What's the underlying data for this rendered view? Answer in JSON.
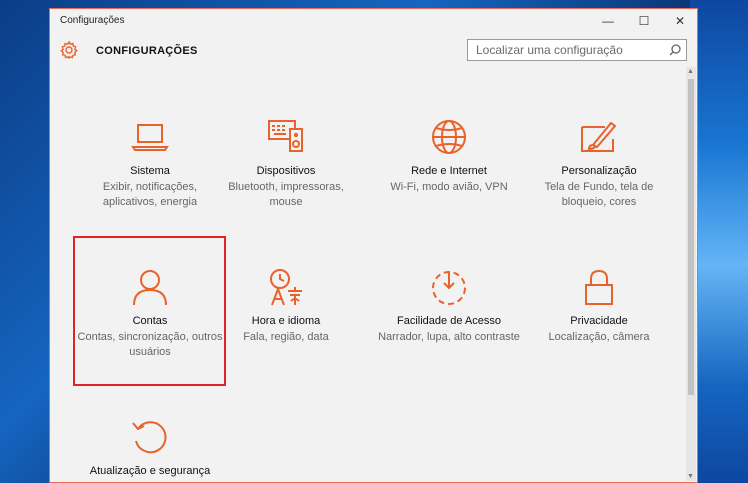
{
  "window": {
    "title": "Configurações"
  },
  "window_controls": {
    "minimize": "—",
    "maximize": "☐",
    "close": "✕"
  },
  "header": {
    "title": "CONFIGURAÇÕES"
  },
  "search": {
    "placeholder": "Localizar uma configuração"
  },
  "accent_color": "#e8632b",
  "tiles": [
    {
      "name": "Sistema",
      "desc": "Exibir, notificações, aplicativos, energia",
      "icon": "laptop-icon"
    },
    {
      "name": "Dispositivos",
      "desc": "Bluetooth, impressoras, mouse",
      "icon": "devices-icon"
    },
    {
      "name": "Rede e Internet",
      "desc": "Wi-Fi, modo avião, VPN",
      "icon": "globe-icon"
    },
    {
      "name": "Personalização",
      "desc": "Tela de Fundo, tela de bloqueio, cores",
      "icon": "paint-icon"
    },
    {
      "name": "Contas",
      "desc": "Contas, sincronização, outros usuários",
      "icon": "person-icon"
    },
    {
      "name": "Hora e idioma",
      "desc": "Fala, região, data",
      "icon": "time-language-icon"
    },
    {
      "name": "Facilidade de Acesso",
      "desc": "Narrador, lupa, alto contraste",
      "icon": "ease-of-access-icon"
    },
    {
      "name": "Privacidade",
      "desc": "Localização, câmera",
      "icon": "lock-icon"
    },
    {
      "name": "Atualização e segurança",
      "desc": "",
      "icon": "update-icon"
    }
  ]
}
